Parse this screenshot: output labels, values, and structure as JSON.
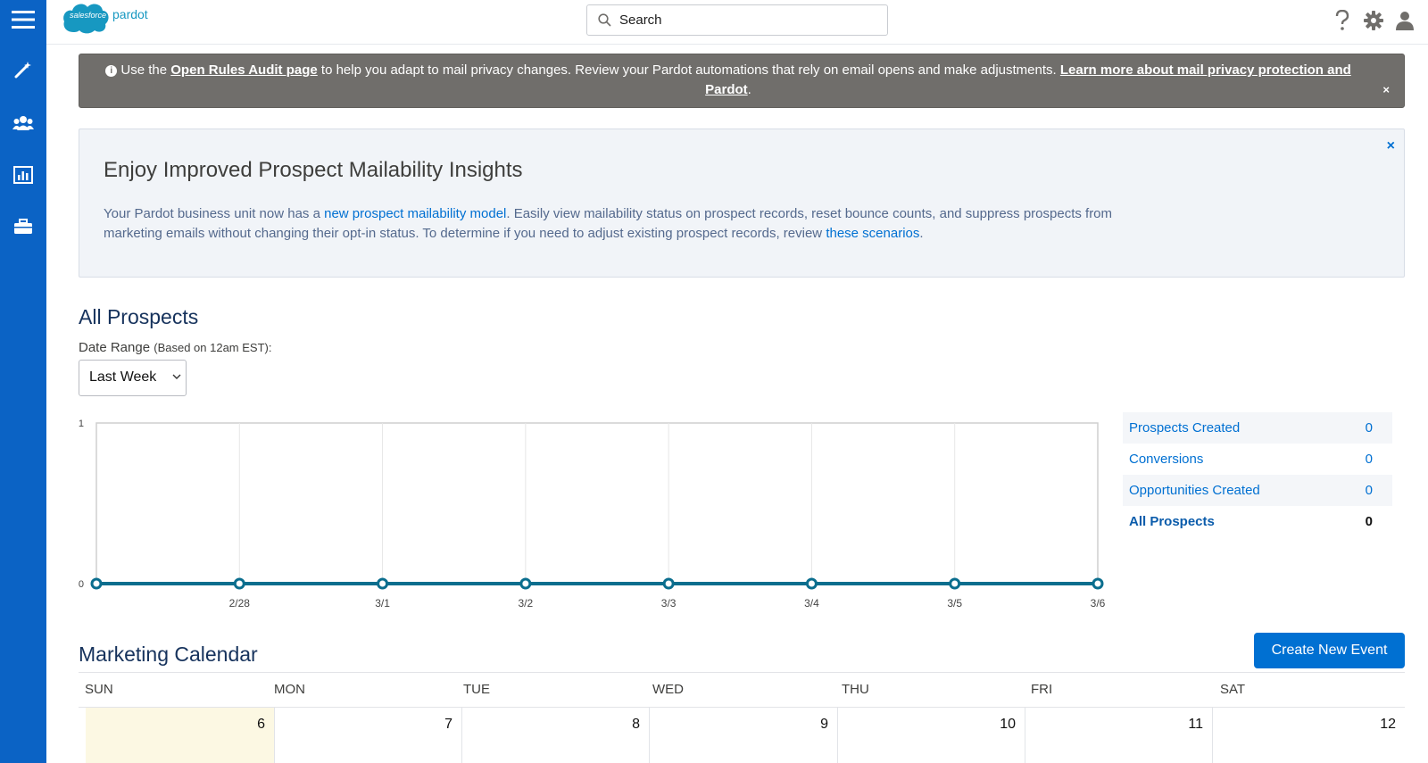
{
  "app": {
    "brand_small": "salesforce",
    "brand_product": "pardot"
  },
  "search": {
    "placeholder": "Search"
  },
  "notice": {
    "prefix": "Use the",
    "link1": "Open Rules Audit page",
    "middle": "to help you adapt to mail privacy changes. Review your Pardot automations that rely on email opens and make adjustments.",
    "link2": "Learn more about mail privacy protection and Pardot",
    "suffix": ".",
    "close": "×"
  },
  "insight": {
    "title": "Enjoy Improved Prospect Mailability Insights",
    "text1": "Your Pardot business unit now has a",
    "link1": "new prospect mailability model",
    "text2": ". Easily view mailability status on prospect records, reset bounce counts, and suppress prospects from marketing emails without changing their opt-in status. To determine if you need to adjust existing prospect records, review",
    "link2": "these scenarios",
    "text3": ".",
    "close": "×"
  },
  "prospects": {
    "title": "All Prospects",
    "date_label": "Date Range",
    "date_note": "(Based on 12am EST):",
    "date_value": "Last Week"
  },
  "stats": [
    {
      "label": "Prospects Created",
      "value": "0"
    },
    {
      "label": "Conversions",
      "value": "0"
    },
    {
      "label": "Opportunities Created",
      "value": "0"
    },
    {
      "label": "All Prospects",
      "value": "0"
    }
  ],
  "chart_data": {
    "type": "line",
    "categories": [
      "",
      "2/28",
      "3/1",
      "3/2",
      "3/3",
      "3/4",
      "3/5",
      "3/6"
    ],
    "series": [
      {
        "values": [
          0,
          0,
          0,
          0,
          0,
          0,
          0,
          0
        ]
      }
    ],
    "ylim": [
      0,
      1
    ],
    "yticks": [
      "0",
      "1"
    ],
    "grid": true,
    "color": "#0b6e8e"
  },
  "calendar": {
    "title": "Marketing Calendar",
    "create_label": "Create New Event",
    "days": [
      "SUN",
      "MON",
      "TUE",
      "WED",
      "THU",
      "FRI",
      "SAT"
    ],
    "dates": [
      "6",
      "7",
      "8",
      "9",
      "10",
      "11",
      "12"
    ]
  },
  "icons": {
    "menu": "hamburger-icon",
    "wand": "magic-wand-icon",
    "users": "users-icon",
    "reports": "bar-chart-icon",
    "briefcase": "briefcase-icon",
    "help": "help-icon",
    "settings": "gear-icon",
    "user": "user-icon"
  }
}
